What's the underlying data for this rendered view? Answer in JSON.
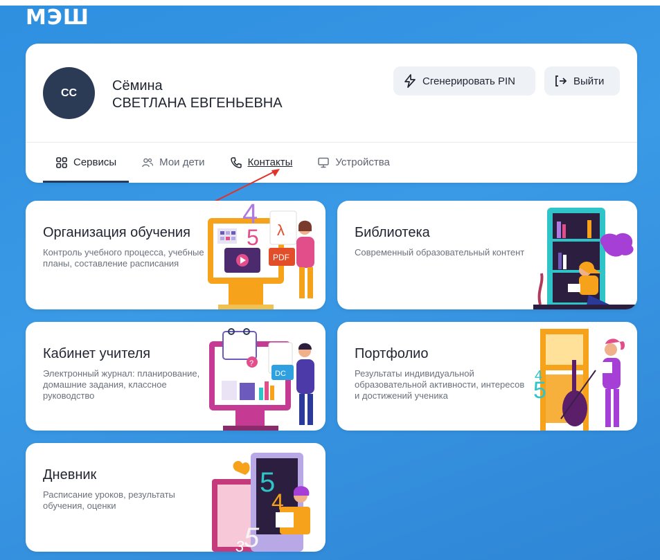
{
  "app": {
    "logo": "МЭШ"
  },
  "profile": {
    "initials": "СС",
    "last_name": "Сёмина",
    "full_name": "СВЕТЛАНА ЕВГЕНЬЕВНА",
    "pin_button": "Сгенерировать PIN",
    "exit_button": "Выйти"
  },
  "tabs": [
    {
      "label": "Сервисы",
      "icon": "grid-icon",
      "active": true
    },
    {
      "label": "Мои дети",
      "icon": "people-icon"
    },
    {
      "label": "Контакты",
      "icon": "phone-icon"
    },
    {
      "label": "Устройства",
      "icon": "monitor-icon"
    }
  ],
  "cards": [
    {
      "title": "Организация обучения",
      "desc": "Контроль учебного процесса, учебные планы, составление расписания"
    },
    {
      "title": "Библиотека",
      "desc": "Современный образовательный контент"
    },
    {
      "title": "Кабинет учителя",
      "desc": "Электронный журнал: планирование, домашние задания, классное руководство"
    },
    {
      "title": "Портфолио",
      "desc": "Результаты индивидуальной образовательной активности, интересов и достижений ученика"
    },
    {
      "title": "Дневник",
      "desc": "Расписание уроков, результаты обучения, оценки"
    }
  ],
  "colors": {
    "background": "#3a9ae6",
    "avatar": "#2b3a55",
    "accent": "#1f3d66",
    "arrow": "#e0332a"
  }
}
